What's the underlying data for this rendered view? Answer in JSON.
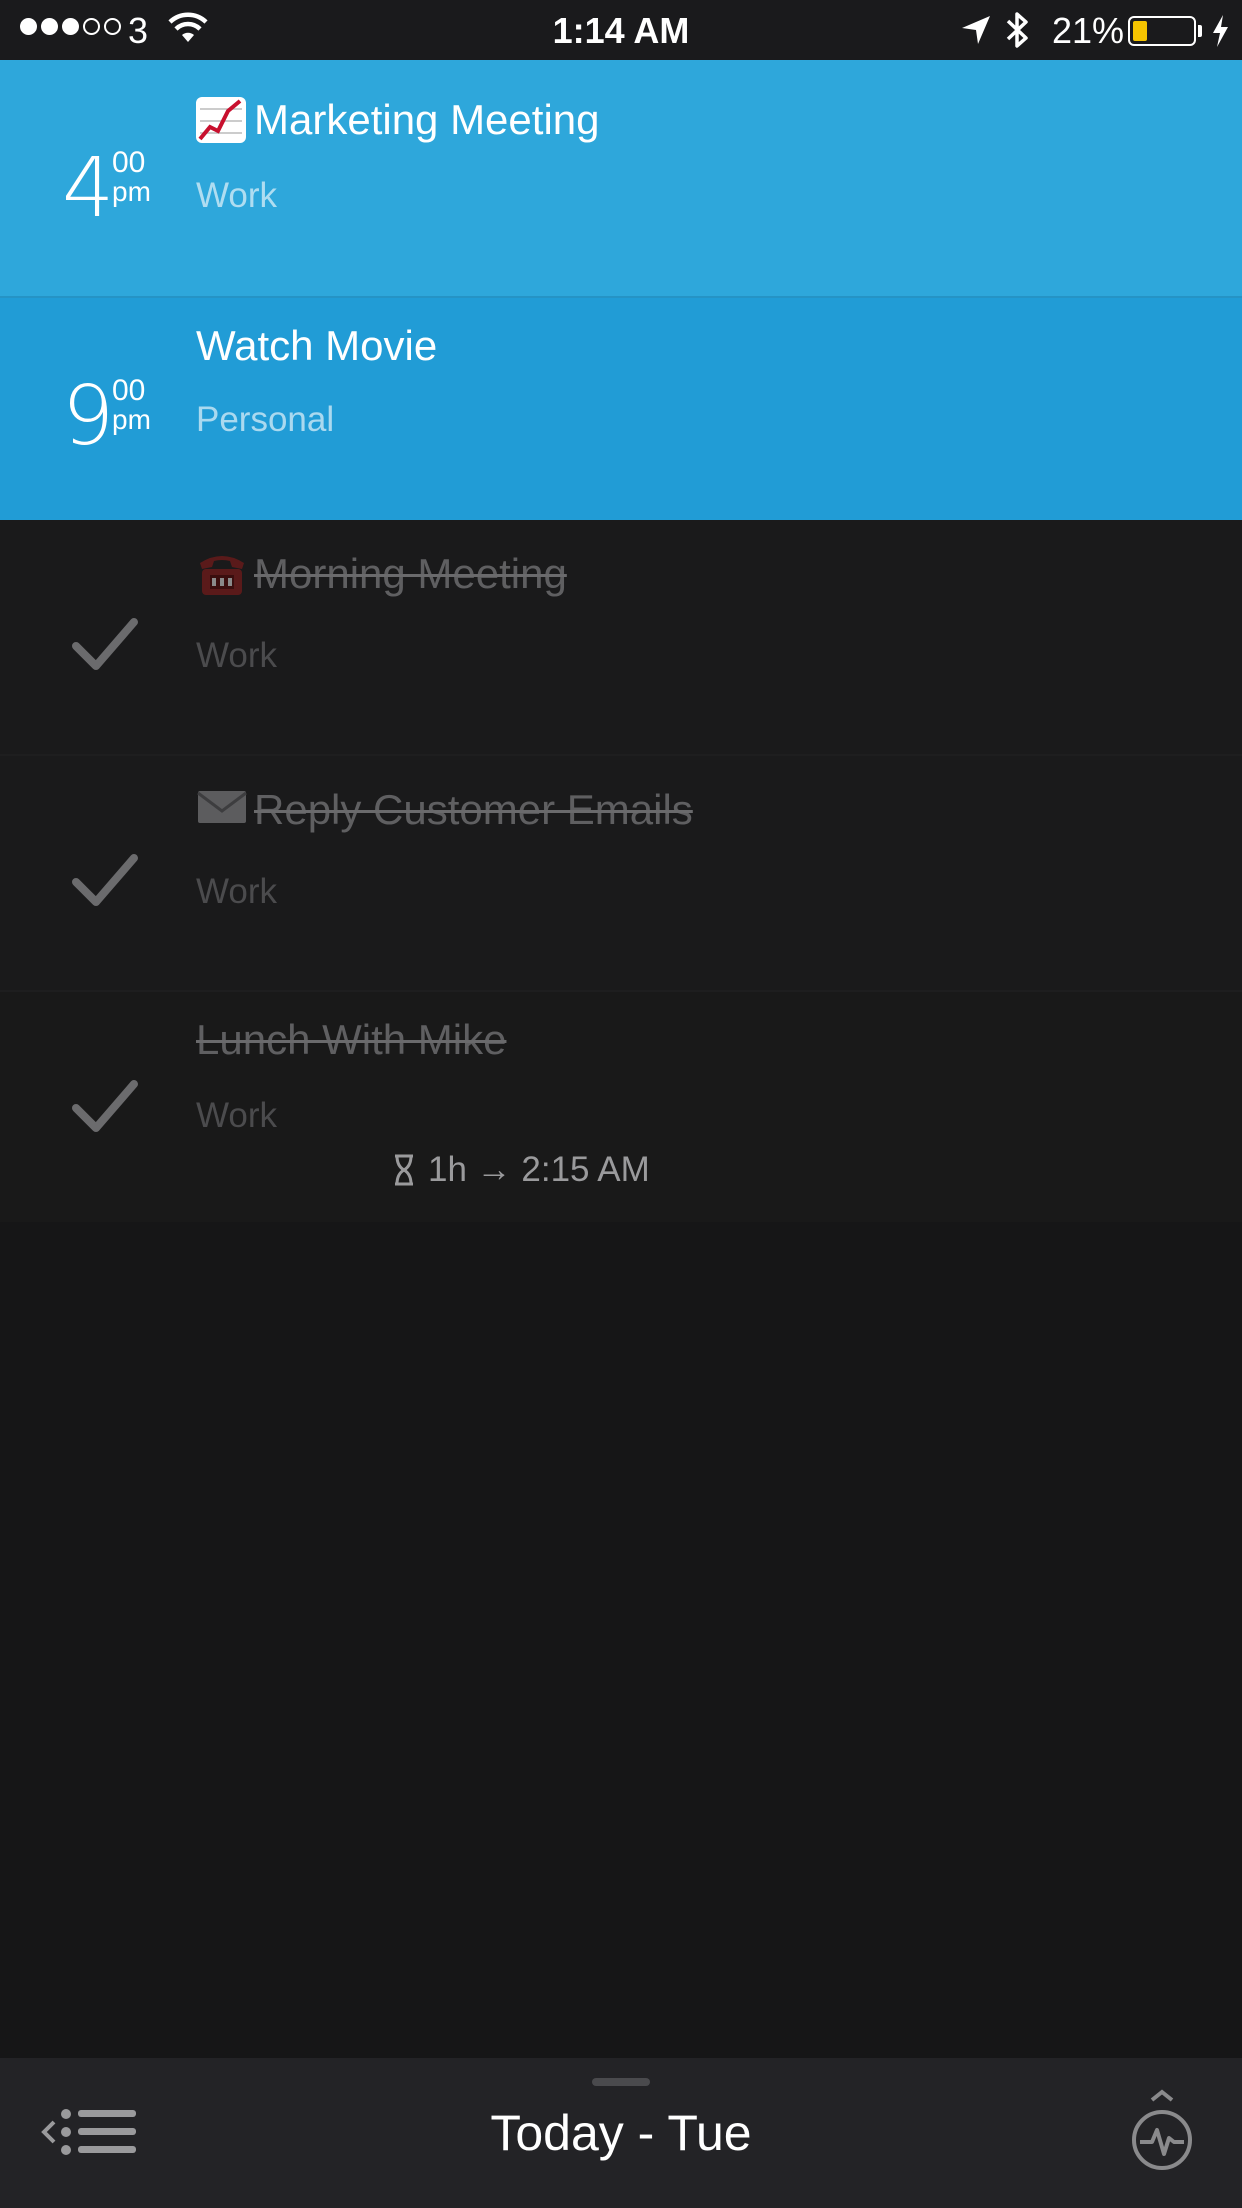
{
  "status_bar": {
    "carrier": "3",
    "time": "1:14 AM",
    "battery_percent": "21%",
    "battery_level": 0.21,
    "signal_bars_filled": 3,
    "signal_bars_total": 5
  },
  "tasks": [
    {
      "hour": "4",
      "minute": "00",
      "ampm": "pm",
      "icon": "chart-increasing-icon",
      "title": "Marketing Meeting",
      "category": "Work",
      "done": false,
      "color": "#2ea7db"
    },
    {
      "hour": "9",
      "minute": "00",
      "ampm": "pm",
      "title": "Watch Movie",
      "category": "Personal",
      "done": false,
      "color": "#219cd6"
    },
    {
      "icon": "telephone-icon",
      "title": "Morning Meeting",
      "category": "Work",
      "done": true
    },
    {
      "icon": "envelope-icon",
      "title": "Reply Customer Emails",
      "category": "Work",
      "done": true
    },
    {
      "title": "Lunch With Mike",
      "category": "Work",
      "done": true
    }
  ],
  "timer": {
    "text": "1h → 2:15 AM"
  },
  "bottom_bar": {
    "title": "Today - Tue"
  }
}
